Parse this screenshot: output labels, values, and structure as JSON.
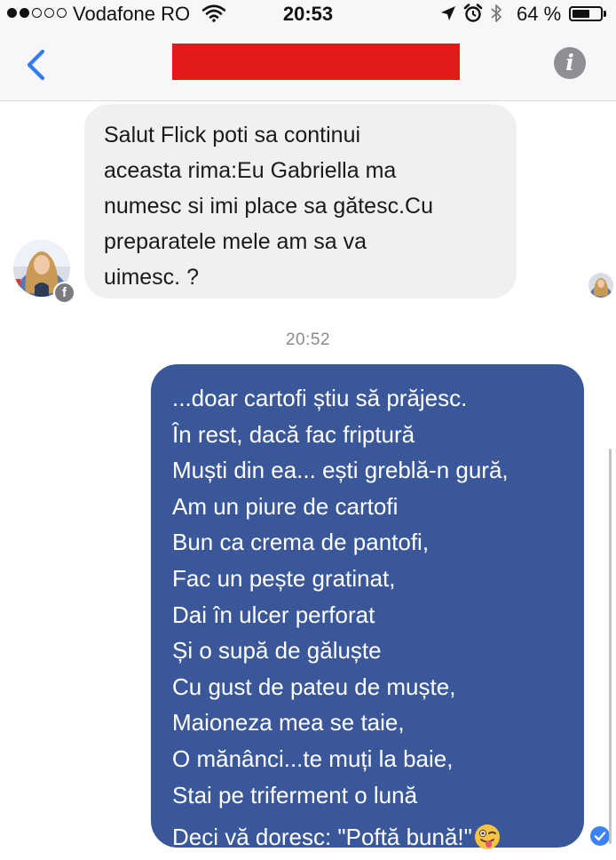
{
  "status_bar": {
    "signal_dots_filled": 2,
    "signal_dots_total": 5,
    "carrier": "Vodafone RO",
    "wifi_icon": "wifi-icon",
    "time": "20:53",
    "status_icons": [
      "location-arrow-icon",
      "alarm-icon",
      "bluetooth-icon"
    ],
    "battery_percent": "64 %",
    "battery_level": 0.64
  },
  "header": {
    "back_icon": "chevron-left-icon",
    "title_redacted_color": "#e31b1b",
    "info_icon": "info-icon",
    "info_label": "i"
  },
  "conversation": {
    "incoming": {
      "text": "Salut Flick poti sa continui\naceasta rima:Eu Gabriella ma\nnumesc si imi place sa gătesc.Cu\npreparatele mele am sa va\nuimesc. ?",
      "avatar": "avatar",
      "platform_badge": "f",
      "bubble_color": "#f1f0f0"
    },
    "read_receipt": "read-receipt-avatar",
    "timestamp": "20:52",
    "outgoing": {
      "bubble_color": "#3a5799",
      "lines": [
        "...doar cartofi știu să prăjesc.",
        "În rest, dacă fac friptură",
        "Muști din ea... ești greblă-n gură,",
        "Am un piure de cartofi",
        "Bun ca crema de pantofi,",
        "Fac un pește gratinat,",
        "Dai în ulcer perforat",
        "Și o supă de găluște",
        "Cu gust de pateu de muște,",
        "Maioneza mea se taie,",
        "O mănânci...te muți la baie,",
        "Stai pe triferment o lună"
      ],
      "closing": "Deci vă doresc: \"Poftă bună!\"",
      "emoji": "winking-tongue-emoji",
      "status_icon": "sent-check-icon"
    }
  },
  "colors": {
    "accent": "#2f7cf6",
    "outgoing_bubble": "#3a5799",
    "incoming_bubble": "#f1f0f0",
    "redaction": "#e31b1b",
    "timestamp": "#8a8a8f"
  }
}
